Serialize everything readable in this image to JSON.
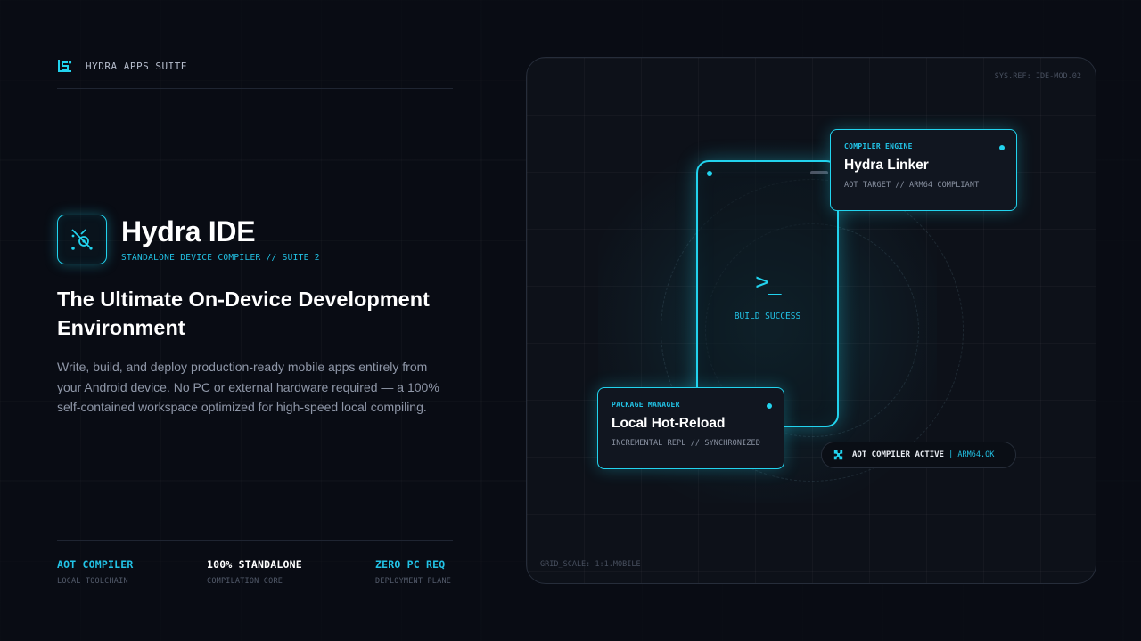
{
  "brand": {
    "label": "HYDRA APPS SUITE",
    "icon": "hydra-suite-logo-icon"
  },
  "app": {
    "title": "Hydra IDE",
    "subtitle": "STANDALONE DEVICE COMPILER // SUITE 2",
    "icon": "compiler-target-icon"
  },
  "headline": "The Ultimate On-Device Development Environment",
  "description": "Write, build, and deploy production-ready mobile apps entirely from your Android device. No PC or external hardware required — a 100% self-contained workspace optimized for high-speed local compiling.",
  "stats": [
    {
      "value": "AOT COMPILER",
      "label": "LOCAL TOOLCHAIN",
      "color": "#22c3e6"
    },
    {
      "value": "100% STANDALONE",
      "label": "COMPILATION CORE",
      "color": "#ffffff"
    },
    {
      "value": "ZERO PC REQ",
      "label": "DEPLOYMENT PLANE",
      "color": "#22c3e6"
    }
  ],
  "panel": {
    "sysref": "SYS.REF: IDE-MOD.02",
    "gridscale": "GRID_SCALE: 1:1.MOBILE",
    "phone": {
      "prompt": ">_",
      "status": "BUILD SUCCESS"
    },
    "compiler_card": {
      "tag": "COMPILER ENGINE",
      "title": "Hydra Linker",
      "meta": "AOT TARGET // ARM64 COMPLIANT"
    },
    "package_card": {
      "tag": "PACKAGE MANAGER",
      "title": "Local Hot-Reload",
      "meta": "INCREMENTAL REPL // SYNCHRONIZED"
    },
    "status_pill": {
      "text": "AOT COMPILER ACTIVE",
      "separator": "|",
      "status": "ARM64.OK",
      "icon": "puzzle-icon"
    }
  },
  "colors": {
    "accent": "#22d3ee",
    "background": "#090c14",
    "panel": "#0d1119"
  }
}
